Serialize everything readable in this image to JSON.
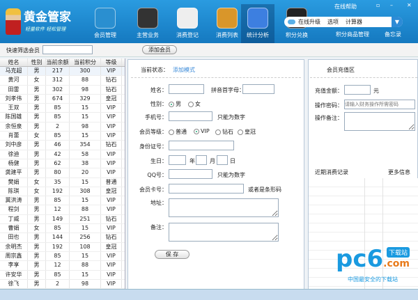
{
  "app": {
    "title": "黄金管家",
    "subtitle": "轻量软件 轻松管理"
  },
  "nav": [
    {
      "label": "会员管理",
      "color": "#2a8fd0"
    },
    {
      "label": "主营业务",
      "color": "#333"
    },
    {
      "label": "消费登记",
      "color": "#eee"
    },
    {
      "label": "消费列表",
      "color": "#d9962a"
    },
    {
      "label": "统计分析",
      "color": "#3d7fe0"
    },
    {
      "label": "积分兑换",
      "color": "#222"
    }
  ],
  "topright": {
    "help": "在线帮助",
    "upgrade": "在线升级",
    "options": "选项",
    "calculator": "计算器",
    "dropdown": "▼",
    "points_goods": "积分商品管理",
    "memo": "备忘录"
  },
  "window": {
    "restore": "▫",
    "minimize": "–",
    "close": "✕"
  },
  "toolbar": {
    "filter_label": "快速筛选会员",
    "filter_value": "",
    "add_member": "添加会员"
  },
  "table": {
    "headers": [
      "姓名",
      "性别",
      "当前余额",
      "当前积分",
      "等级"
    ],
    "rows": [
      [
        "马克超",
        "男",
        "217",
        "300",
        "VIP"
      ],
      [
        "黄河",
        "女",
        "312",
        "88",
        "钻石"
      ],
      [
        "田雷",
        "男",
        "302",
        "98",
        "钻石"
      ],
      [
        "刘孝伟",
        "男",
        "674",
        "329",
        "皇冠"
      ],
      [
        "王双",
        "男",
        "85",
        "15",
        "VIP"
      ],
      [
        "陈国雄",
        "男",
        "85",
        "15",
        "VIP"
      ],
      [
        "余恒泉",
        "男",
        "2",
        "98",
        "VIP"
      ],
      [
        "肖蕾",
        "女",
        "85",
        "15",
        "VIP"
      ],
      [
        "刘中彦",
        "男",
        "46",
        "354",
        "钻石"
      ],
      [
        "徐迪",
        "男",
        "42",
        "58",
        "VIP"
      ],
      [
        "杨健",
        "男",
        "62",
        "38",
        "VIP"
      ],
      [
        "龚建平",
        "男",
        "80",
        "20",
        "VIP"
      ],
      [
        "樊娟",
        "女",
        "35",
        "15",
        "普通"
      ],
      [
        "陈琪",
        "女",
        "192",
        "308",
        "皇冠"
      ],
      [
        "冀洪涛",
        "男",
        "85",
        "15",
        "VIP"
      ],
      [
        "程剑",
        "男",
        "12",
        "88",
        "VIP"
      ],
      [
        "丁威",
        "男",
        "149",
        "251",
        "钻石"
      ],
      [
        "曹娟",
        "女",
        "85",
        "15",
        "VIP"
      ],
      [
        "田也",
        "男",
        "144",
        "256",
        "钻石"
      ],
      [
        "余明杰",
        "男",
        "192",
        "108",
        "皇冠"
      ],
      [
        "周宗鑫",
        "男",
        "85",
        "15",
        "VIP"
      ],
      [
        "李享",
        "男",
        "12",
        "88",
        "VIP"
      ],
      [
        "许安华",
        "男",
        "85",
        "15",
        "VIP"
      ],
      [
        "徐飞",
        "男",
        "2",
        "98",
        "VIP"
      ]
    ]
  },
  "form": {
    "status_label": "当前状态：",
    "status_value": "添加模式",
    "name": "姓名：",
    "pinyin": "拼音首字母：",
    "gender": "性别：",
    "male": "男",
    "female": "女",
    "phone": "手机号：",
    "digits_only": "只能为数字",
    "level": "会员等级：",
    "levels": [
      "普通",
      "VIP",
      "钻石",
      "皇冠"
    ],
    "id_card": "身份证号：",
    "birthday": "生日：",
    "year": "年",
    "month": "月",
    "day": "日",
    "qq": "QQ号：",
    "digits_only2": "只能为数字",
    "card": "会员卡号：",
    "barcode_hint": "或者是条形码",
    "address": "地址：",
    "note": "备注：",
    "save": "保 存"
  },
  "recharge": {
    "title": "会员充值区",
    "amount": "充值金额：",
    "unit": "元",
    "password": "操作密码：",
    "password_placeholder": "请输入财务操作所需密码",
    "remark": "操作备注：",
    "recent": "近期消费记录",
    "more": "更多信息"
  },
  "watermark": {
    "logo": "pc6",
    "com": ".com",
    "badge": "下载站",
    "slogan": "中国最安全的下载站"
  }
}
